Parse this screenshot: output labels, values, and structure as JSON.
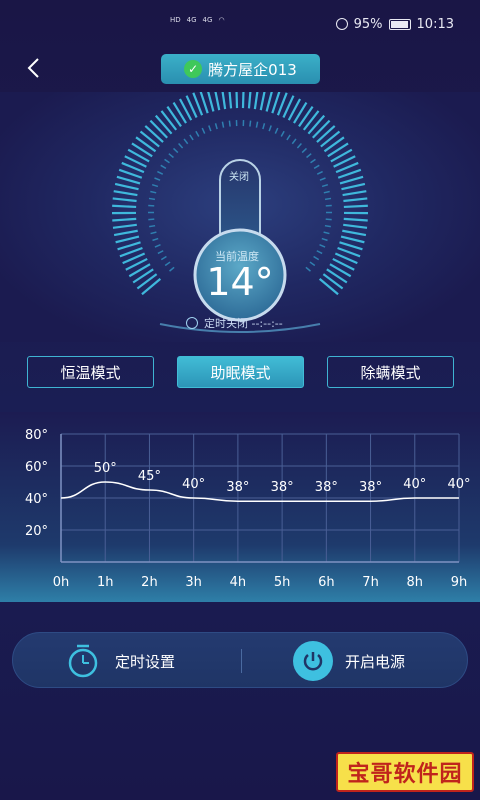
{
  "status_bar": {
    "network_left": "HD",
    "signal_1": "4G",
    "signal_2": "4G",
    "battery": "95%",
    "time": "10:13"
  },
  "header": {
    "back_icon": "chevron-left-icon",
    "device_name": "腾方屋企013",
    "connected_icon": "check-circle-icon",
    "colors": {
      "pill": "#35a6c2",
      "check": "#3fc85a"
    }
  },
  "dial": {
    "state_label": "关闭",
    "current_temp_label": "当前温度",
    "current_temp_value": "14°",
    "timer_label": "定时关闭 --:--:--"
  },
  "modes": [
    {
      "label": "恒温模式",
      "active": false
    },
    {
      "label": "助眠模式",
      "active": true
    },
    {
      "label": "除螨模式",
      "active": false
    }
  ],
  "chart_data": {
    "type": "line",
    "x": [
      "0h",
      "1h",
      "2h",
      "3h",
      "4h",
      "5h",
      "6h",
      "7h",
      "8h",
      "9h"
    ],
    "y_ticks": [
      "80°",
      "60°",
      "40°",
      "20°"
    ],
    "ylim": [
      0,
      80
    ],
    "values": [
      40,
      50,
      45,
      40,
      38,
      38,
      38,
      38,
      40,
      40
    ],
    "point_labels": [
      "",
      "50°",
      "45°",
      "40°",
      "38°",
      "38°",
      "38°",
      "38°",
      "40°",
      "40°"
    ],
    "grid": true,
    "line_color": "#ffffff"
  },
  "bottom_bar": {
    "timer_label": "定时设置",
    "timer_icon": "alarm-clock-icon",
    "power_label": "开启电源",
    "power_icon": "power-icon"
  },
  "watermark": "宝哥软件园"
}
